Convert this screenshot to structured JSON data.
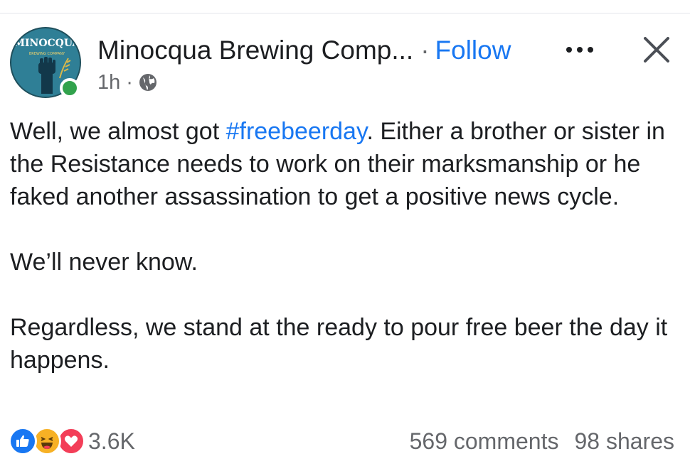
{
  "post": {
    "author": {
      "name": "Minocqua Brewing Comp...",
      "avatar_text": "MINOCQUA",
      "avatar_subtext": "BREWING COMPANY",
      "online": true
    },
    "separator": "·",
    "follow_label": "Follow",
    "time": "1h",
    "audience_icon": "globe-icon",
    "more_icon": "more-options-icon",
    "close_icon": "close-icon",
    "body": {
      "p1_prefix": "Well, we almost got ",
      "p1_hashtag": "#freebeerday",
      "p1_suffix": ".  Either a brother or sister in the Resistance needs to work on their marksmanship or he faked another assassination to get a positive news cycle.",
      "p2": "We’ll never know.",
      "p3": "Regardless, we stand at the ready to pour free beer the day it happens."
    },
    "reactions": {
      "icons": [
        "like-icon",
        "haha-icon",
        "love-icon"
      ],
      "count": "3.6K"
    },
    "comments": "569 comments",
    "shares": "98 shares"
  },
  "colors": {
    "link_blue": "#1877f2",
    "meta_gray": "#65676b",
    "online_green": "#31a24c",
    "love_red": "#f33e58",
    "haha_yellow": "#f7b125"
  }
}
